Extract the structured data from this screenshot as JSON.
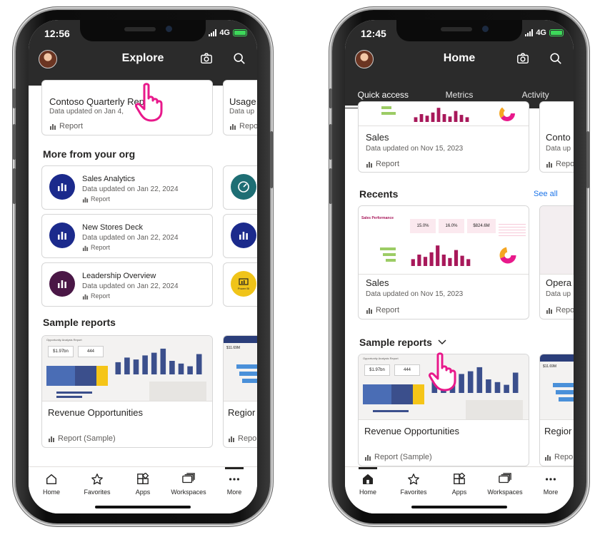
{
  "left": {
    "status": {
      "time": "12:56",
      "network": "4G"
    },
    "header": {
      "title": "Explore",
      "camera_icon": "camera-icon",
      "search_icon": "search-icon"
    },
    "top_cards": [
      {
        "title": "Contoso Quarterly Rep",
        "subtitle": "Data updated on Jan 4,",
        "type": "Report"
      },
      {
        "title": "Usage",
        "subtitle": "Data up",
        "type": "Repo"
      }
    ],
    "org_section": {
      "title": "More from your org"
    },
    "org_items": [
      {
        "title": "Sales Analytics",
        "subtitle": "Data updated on Jan 22, 2024",
        "type": "Report",
        "color": "#1b2a8c"
      },
      {
        "title": "New Stores Deck",
        "subtitle": "Data updated on Jan 22, 2024",
        "type": "Report",
        "color": "#1b2a8c"
      },
      {
        "title": "Leadership Overview",
        "subtitle": "Data updated on Jan 22, 2024",
        "type": "Report",
        "color": "#4a1746"
      }
    ],
    "org_side_items": [
      {
        "color": "#1e6e74"
      },
      {
        "color": "#1b2a8c"
      },
      {
        "color": "#f0c419",
        "label": "Power BI"
      }
    ],
    "samples_section": {
      "title": "Sample reports"
    },
    "sample_cards": [
      {
        "title": "Revenue Opportunities",
        "type": "Report (Sample)",
        "thumb_title": "Opportunity Analysis Report",
        "kpi1": "$1.97bn",
        "kpi2": "444",
        "bar_levels": [
          0.45,
          0.62,
          0.55,
          0.7,
          0.8,
          0.95,
          0.5,
          0.4,
          0.3,
          0.75
        ]
      },
      {
        "title": "Regior",
        "type": "Repo",
        "kpi": "$11.69M"
      }
    ]
  },
  "right": {
    "status": {
      "time": "12:45",
      "network": "4G"
    },
    "header": {
      "title": "Home",
      "camera_icon": "camera-icon",
      "search_icon": "search-icon"
    },
    "tabs": [
      "Quick access",
      "Metrics",
      "Activity"
    ],
    "quick_cards": [
      {
        "title": "Sales",
        "subtitle": "Data updated on Nov 15, 2023",
        "type": "Report"
      },
      {
        "title": "Conto",
        "subtitle": "Data up",
        "type": "Repo"
      }
    ],
    "recents": {
      "title": "Recents",
      "see_all": "See all"
    },
    "recent_cards": [
      {
        "title": "Sales",
        "subtitle": "Data updated on Nov 15, 2023",
        "type": "Report",
        "thumb_title": "Sales Performance",
        "kpis": [
          "15.0%",
          "16.0%",
          "$824.6M"
        ],
        "bar_levels": [
          0.3,
          0.5,
          0.4,
          0.6,
          0.9,
          0.5,
          0.35,
          0.7,
          0.45,
          0.3
        ]
      },
      {
        "title": "Opera",
        "subtitle": "Data up",
        "type": "Repo"
      }
    ],
    "samples_section": {
      "title": "Sample reports"
    },
    "sample_cards": [
      {
        "title": "Revenue Opportunities",
        "type": "Report (Sample)",
        "thumb_title": "Opportunity Analysis Report",
        "kpi1": "$1.97bn",
        "kpi2": "444",
        "bar_levels": [
          0.45,
          0.62,
          0.55,
          0.7,
          0.8,
          0.95,
          0.5,
          0.4,
          0.3,
          0.75
        ]
      },
      {
        "title": "Regior",
        "type": "Repo",
        "kpi": "$11.69M"
      }
    ]
  },
  "nav": {
    "items": [
      {
        "label": "Home",
        "icon": "home-icon"
      },
      {
        "label": "Favorites",
        "icon": "star-icon"
      },
      {
        "label": "Apps",
        "icon": "apps-icon"
      },
      {
        "label": "Workspaces",
        "icon": "workspaces-icon"
      },
      {
        "label": "More",
        "icon": "more-icon"
      }
    ],
    "left_active": "More",
    "right_active": "Home"
  },
  "colors": {
    "header_bg": "#2b2b2b",
    "accent_pink": "#e8198b",
    "link_blue": "#1a73e8",
    "chart_navy": "#3b4f8c",
    "chart_yellow": "#f5c518",
    "chart_maroon": "#a8185a"
  }
}
